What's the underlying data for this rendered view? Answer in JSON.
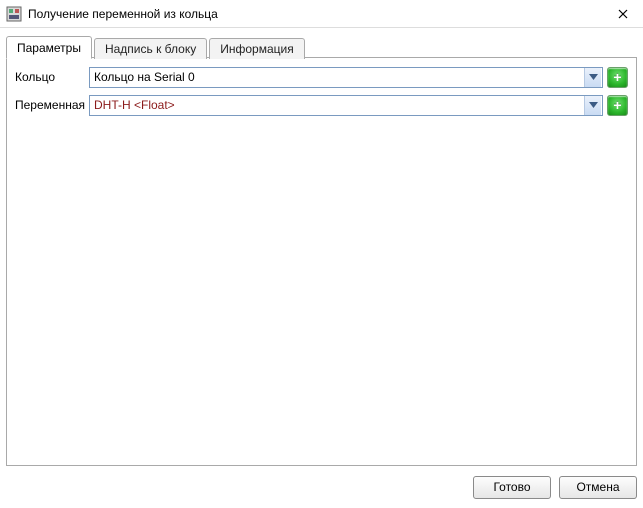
{
  "window": {
    "title": "Получение переменной из кольца"
  },
  "tabs": {
    "parameters": "Параметры",
    "caption": "Надпись к блоку",
    "info": "Информация"
  },
  "form": {
    "ring_label": "Кольцо",
    "ring_value": "Кольцо  на Serial 0",
    "var_label": "Переменная",
    "var_value": "DHT-H <Float>"
  },
  "buttons": {
    "ok": "Готово",
    "cancel": "Отмена"
  }
}
